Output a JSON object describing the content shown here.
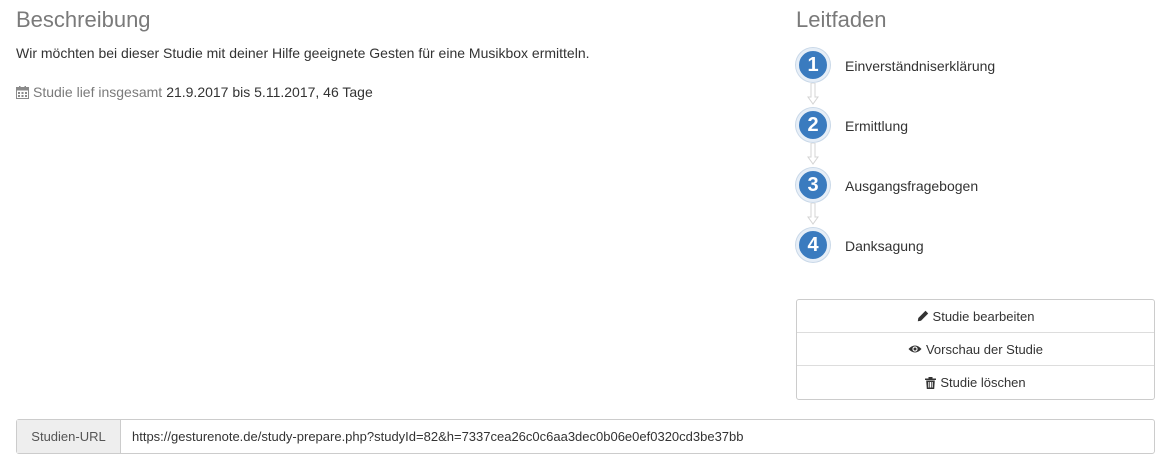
{
  "description": {
    "title": "Beschreibung",
    "text": "Wir möchten bei dieser Studie mit deiner Hilfe geeignete Gesten für eine Musikbox ermitteln.",
    "run_label": "Studie lief insgesamt",
    "run_value": "21.9.2017 bis 5.11.2017, 46 Tage",
    "run_icon": "calendar-icon"
  },
  "guide": {
    "title": "Leitfaden",
    "accent": "#3a7bbf",
    "steps": [
      {
        "number": "1",
        "label": "Einverständniserklärung"
      },
      {
        "number": "2",
        "label": "Ermittlung"
      },
      {
        "number": "3",
        "label": "Ausgangsfragebogen"
      },
      {
        "number": "4",
        "label": "Danksagung"
      }
    ]
  },
  "actions": [
    {
      "label": "Studie bearbeiten",
      "icon": "pencil-icon"
    },
    {
      "label": "Vorschau der Studie",
      "icon": "eye-icon"
    },
    {
      "label": "Studie löschen",
      "icon": "trash-icon"
    }
  ],
  "url": {
    "label": "Studien-URL",
    "value": "https://gesturenote.de/study-prepare.php?studyId=82&h=7337cea26c0c6aa3dec0b06e0ef0320cd3be37bb"
  }
}
